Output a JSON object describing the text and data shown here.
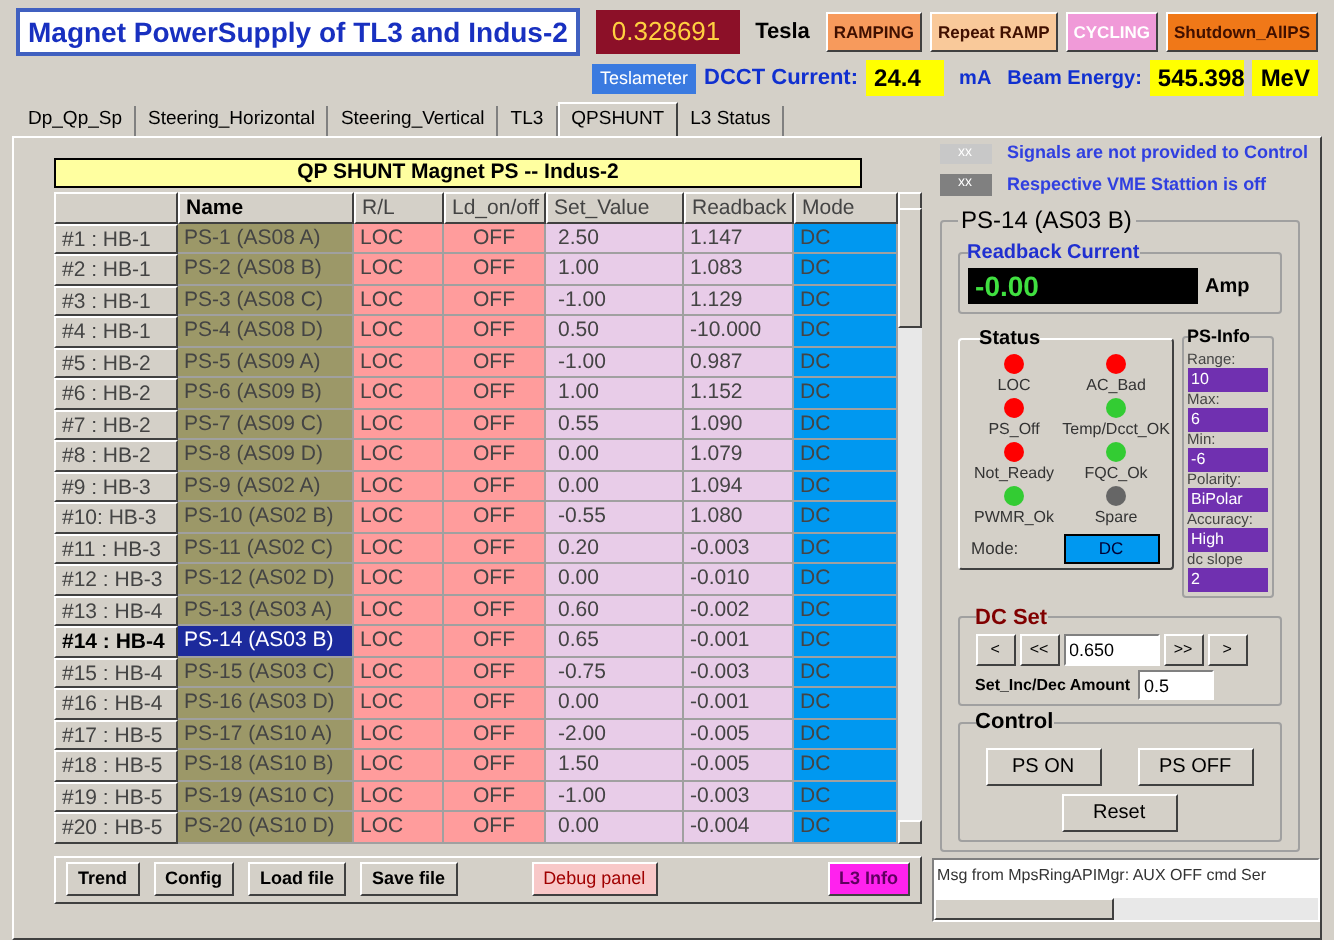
{
  "header": {
    "title": "Magnet PowerSupply of TL3 and Indus-2",
    "tesla_value": "0.328691",
    "tesla_unit": "Tesla",
    "mode_buttons": [
      {
        "label": "RAMPING",
        "color": "#f79a5c"
      },
      {
        "label": "Repeat RAMP",
        "color": "#f9c99a"
      },
      {
        "label": "CYCLING",
        "color": "#f09ad8"
      },
      {
        "label": "Shutdown_AllPS",
        "color": "#f07818"
      }
    ],
    "teslameter_button": "Teslameter",
    "dcct_label": "DCCT Current:",
    "dcct_value": "24.4",
    "dcct_unit": "mA",
    "beam_label": "Beam Energy:",
    "beam_value": "545.398",
    "beam_unit": "MeV"
  },
  "tabs": [
    {
      "label": "Dp_Qp_Sp",
      "selected": false
    },
    {
      "label": "Steering_Horizontal",
      "selected": false
    },
    {
      "label": "Steering_Vertical",
      "selected": false
    },
    {
      "label": "TL3",
      "selected": false
    },
    {
      "label": "QPSHUNT",
      "selected": true
    },
    {
      "label": "L3 Status",
      "selected": false
    }
  ],
  "table": {
    "title": "QP SHUNT Magnet PS -- Indus-2",
    "columns": [
      "Name",
      "R/L",
      "Ld_on/off",
      "Set_Value",
      "Readback",
      "Mode"
    ],
    "rows": [
      {
        "header": "#1  : HB-1",
        "name": "PS-1 (AS08 A)",
        "rl": "LOC",
        "ld": "OFF",
        "set": "2.50",
        "readback": "1.147",
        "mode": "DC",
        "selected": false
      },
      {
        "header": "#2  : HB-1",
        "name": "PS-2 (AS08 B)",
        "rl": "LOC",
        "ld": "OFF",
        "set": "1.00",
        "readback": "1.083",
        "mode": "DC",
        "selected": false
      },
      {
        "header": "#3  : HB-1",
        "name": "PS-3 (AS08 C)",
        "rl": "LOC",
        "ld": "OFF",
        "set": "-1.00",
        "readback": "1.129",
        "mode": "DC",
        "selected": false
      },
      {
        "header": "#4  : HB-1",
        "name": "PS-4 (AS08 D)",
        "rl": "LOC",
        "ld": "OFF",
        "set": "0.50",
        "readback": "-10.000",
        "mode": "DC",
        "selected": false
      },
      {
        "header": "#5  : HB-2",
        "name": "PS-5 (AS09 A)",
        "rl": "LOC",
        "ld": "OFF",
        "set": "-1.00",
        "readback": "0.987",
        "mode": "DC",
        "selected": false
      },
      {
        "header": "#6  : HB-2",
        "name": "PS-6 (AS09 B)",
        "rl": "LOC",
        "ld": "OFF",
        "set": "1.00",
        "readback": "1.152",
        "mode": "DC",
        "selected": false
      },
      {
        "header": "#7  : HB-2",
        "name": "PS-7 (AS09 C)",
        "rl": "LOC",
        "ld": "OFF",
        "set": "0.55",
        "readback": "1.090",
        "mode": "DC",
        "selected": false
      },
      {
        "header": "#8  : HB-2",
        "name": "PS-8 (AS09 D)",
        "rl": "LOC",
        "ld": "OFF",
        "set": "0.00",
        "readback": "1.079",
        "mode": "DC",
        "selected": false
      },
      {
        "header": "#9  : HB-3",
        "name": "PS-9 (AS02 A)",
        "rl": "LOC",
        "ld": "OFF",
        "set": "0.00",
        "readback": "1.094",
        "mode": "DC",
        "selected": false
      },
      {
        "header": "#10: HB-3",
        "name": "PS-10 (AS02 B)",
        "rl": "LOC",
        "ld": "OFF",
        "set": "-0.55",
        "readback": "1.080",
        "mode": "DC",
        "selected": false
      },
      {
        "header": "#11 : HB-3",
        "name": "PS-11 (AS02 C)",
        "rl": "LOC",
        "ld": "OFF",
        "set": "0.20",
        "readback": "-0.003",
        "mode": "DC",
        "selected": false
      },
      {
        "header": "#12 : HB-3",
        "name": "PS-12 (AS02 D)",
        "rl": "LOC",
        "ld": "OFF",
        "set": "0.00",
        "readback": "-0.010",
        "mode": "DC",
        "selected": false
      },
      {
        "header": "#13 : HB-4",
        "name": "PS-13 (AS03 A)",
        "rl": "LOC",
        "ld": "OFF",
        "set": "0.60",
        "readback": "-0.002",
        "mode": "DC",
        "selected": false
      },
      {
        "header": "#14 : HB-4",
        "name": "PS-14 (AS03 B)",
        "rl": "LOC",
        "ld": "OFF",
        "set": "0.65",
        "readback": "-0.001",
        "mode": "DC",
        "selected": true
      },
      {
        "header": "#15 : HB-4",
        "name": "PS-15 (AS03 C)",
        "rl": "LOC",
        "ld": "OFF",
        "set": "-0.75",
        "readback": "-0.003",
        "mode": "DC",
        "selected": false
      },
      {
        "header": "#16 : HB-4",
        "name": "PS-16 (AS03 D)",
        "rl": "LOC",
        "ld": "OFF",
        "set": "0.00",
        "readback": "-0.001",
        "mode": "DC",
        "selected": false
      },
      {
        "header": "#17 : HB-5",
        "name": "PS-17 (AS10 A)",
        "rl": "LOC",
        "ld": "OFF",
        "set": "-2.00",
        "readback": "-0.005",
        "mode": "DC",
        "selected": false
      },
      {
        "header": "#18 : HB-5",
        "name": "PS-18 (AS10 B)",
        "rl": "LOC",
        "ld": "OFF",
        "set": "1.50",
        "readback": "-0.005",
        "mode": "DC",
        "selected": false
      },
      {
        "header": "#19 : HB-5",
        "name": "PS-19 (AS10 C)",
        "rl": "LOC",
        "ld": "OFF",
        "set": "-1.00",
        "readback": "-0.003",
        "mode": "DC",
        "selected": false
      },
      {
        "header": "#20 : HB-5",
        "name": "PS-20 (AS10 D)",
        "rl": "LOC",
        "ld": "OFF",
        "set": "0.00",
        "readback": "-0.004",
        "mode": "DC",
        "selected": false
      }
    ]
  },
  "buttons": [
    {
      "label": "Trend",
      "kind": "plain"
    },
    {
      "label": "Config",
      "kind": "plain"
    },
    {
      "label": "Load file",
      "kind": "plain"
    },
    {
      "label": "Save file",
      "kind": "plain"
    },
    {
      "label": "Debug panel",
      "kind": "debug"
    },
    {
      "label": "L3 Info",
      "kind": "info"
    }
  ],
  "legend": [
    {
      "box": "xx",
      "text": "Signals are not provided to Control",
      "color": "#c8c8c8"
    },
    {
      "box": "xx",
      "text": "Respective VME Stattion is off",
      "color": "#808080"
    }
  ],
  "ps_panel": {
    "title": "PS-14 (AS03 B)",
    "readback_label": "Readback Current",
    "readback_value": "-0.00",
    "readback_unit": "Amp",
    "status_title": "Status",
    "leds": [
      {
        "label": "LOC",
        "color": "#ff0000"
      },
      {
        "label": "AC_Bad",
        "color": "#ff0000"
      },
      {
        "label": "PS_Off",
        "color": "#ff0000"
      },
      {
        "label": "Temp/Dcct_OK",
        "color": "#33cc33"
      },
      {
        "label": "Not_Ready",
        "color": "#ff0000"
      },
      {
        "label": "FQC_Ok",
        "color": "#33cc33"
      },
      {
        "label": "PWMR_Ok",
        "color": "#33cc33"
      },
      {
        "label": "Spare",
        "color": "#666666"
      }
    ],
    "mode_label": "Mode:",
    "mode_value": "DC",
    "info_title": "PS-Info",
    "info": [
      {
        "label": "Range:",
        "value": "10"
      },
      {
        "label": "Max:",
        "value": "6"
      },
      {
        "label": "Min:",
        "value": "-6"
      },
      {
        "label": "Polarity:",
        "value": "BiPolar"
      },
      {
        "label": "Accuracy:",
        "value": "High"
      },
      {
        "label": "dc slope",
        "value": "2"
      }
    ],
    "dc_set": {
      "title": "DC Set",
      "left_buttons": [
        "<",
        "<<"
      ],
      "value": "0.650",
      "right_buttons": [
        ">>",
        ">"
      ],
      "amount_label": "Set_Inc/Dec Amount",
      "amount_value": "0.5"
    },
    "control": {
      "title": "Control",
      "buttons": [
        "PS ON",
        "PS OFF",
        "Reset"
      ]
    }
  },
  "message": "Msg from MpsRingAPIMgr: AUX OFF cmd Ser"
}
